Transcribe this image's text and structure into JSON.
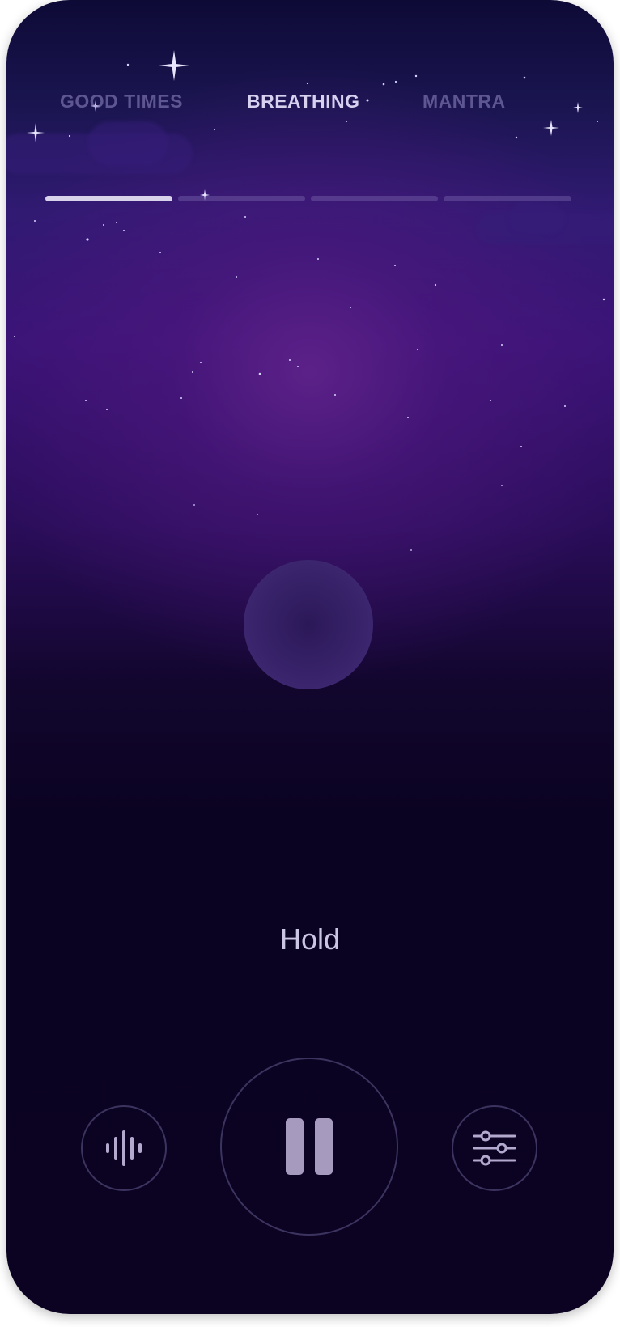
{
  "tabs": [
    {
      "label": "GOOD TIMES",
      "active": false
    },
    {
      "label": "BREATHING",
      "active": true
    },
    {
      "label": "MANTRA",
      "active": false
    }
  ],
  "progress": {
    "segments": 4,
    "current_segment_fill": 1.0,
    "completed_segments": 1
  },
  "breathing": {
    "phase_label": "Hold"
  },
  "controls": {
    "left_icon": "sound-wave-icon",
    "center_icon": "pause-icon",
    "right_icon": "sliders-icon"
  },
  "colors": {
    "active_tab": "#d7d1ef",
    "inactive_tab": "#7d75a8",
    "accent_purple": "#5a1e8a",
    "background_dark": "#0b0321"
  }
}
